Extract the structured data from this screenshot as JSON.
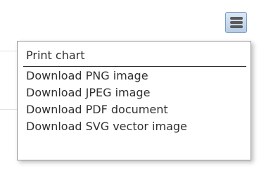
{
  "context_menu": {
    "button_icon": "hamburger-menu-icon",
    "items": [
      {
        "label": "Print chart"
      },
      {
        "label": "Download PNG image"
      },
      {
        "label": "Download JPEG image"
      },
      {
        "label": "Download PDF document"
      },
      {
        "label": "Download SVG vector image"
      }
    ]
  },
  "colors": {
    "menu_text": "#303030",
    "button_border": "#7a9cc4",
    "button_fill": "#c6d8ec",
    "icon_bar": "#5a5a5a"
  }
}
